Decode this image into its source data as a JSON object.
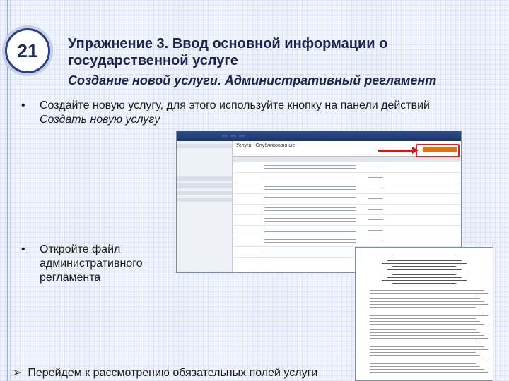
{
  "slide": {
    "number": "21",
    "title": "Упражнение 3. Ввод основной информации о государственной услуге",
    "subtitle": "Создание новой услуги. Административный регламент"
  },
  "bullets": {
    "bullet1": "Создайте новую услугу, для этого используйте кнопку на панели действий",
    "bullet1_command": "Создать новую услугу",
    "bullet2": "Откройте файл административного регламента",
    "bullet3": "Перейдем к рассмотрению обязательных полей услуги"
  },
  "screenshot": {
    "header": "Услуги",
    "tab_published": "Опубликованные"
  },
  "colors": {
    "title": "#1b2550",
    "highlight": "#e02020",
    "action_button": "#d9731c"
  },
  "icons": {
    "bullet": "bullet-dot",
    "arrow": "arrow-bullet-icon"
  }
}
